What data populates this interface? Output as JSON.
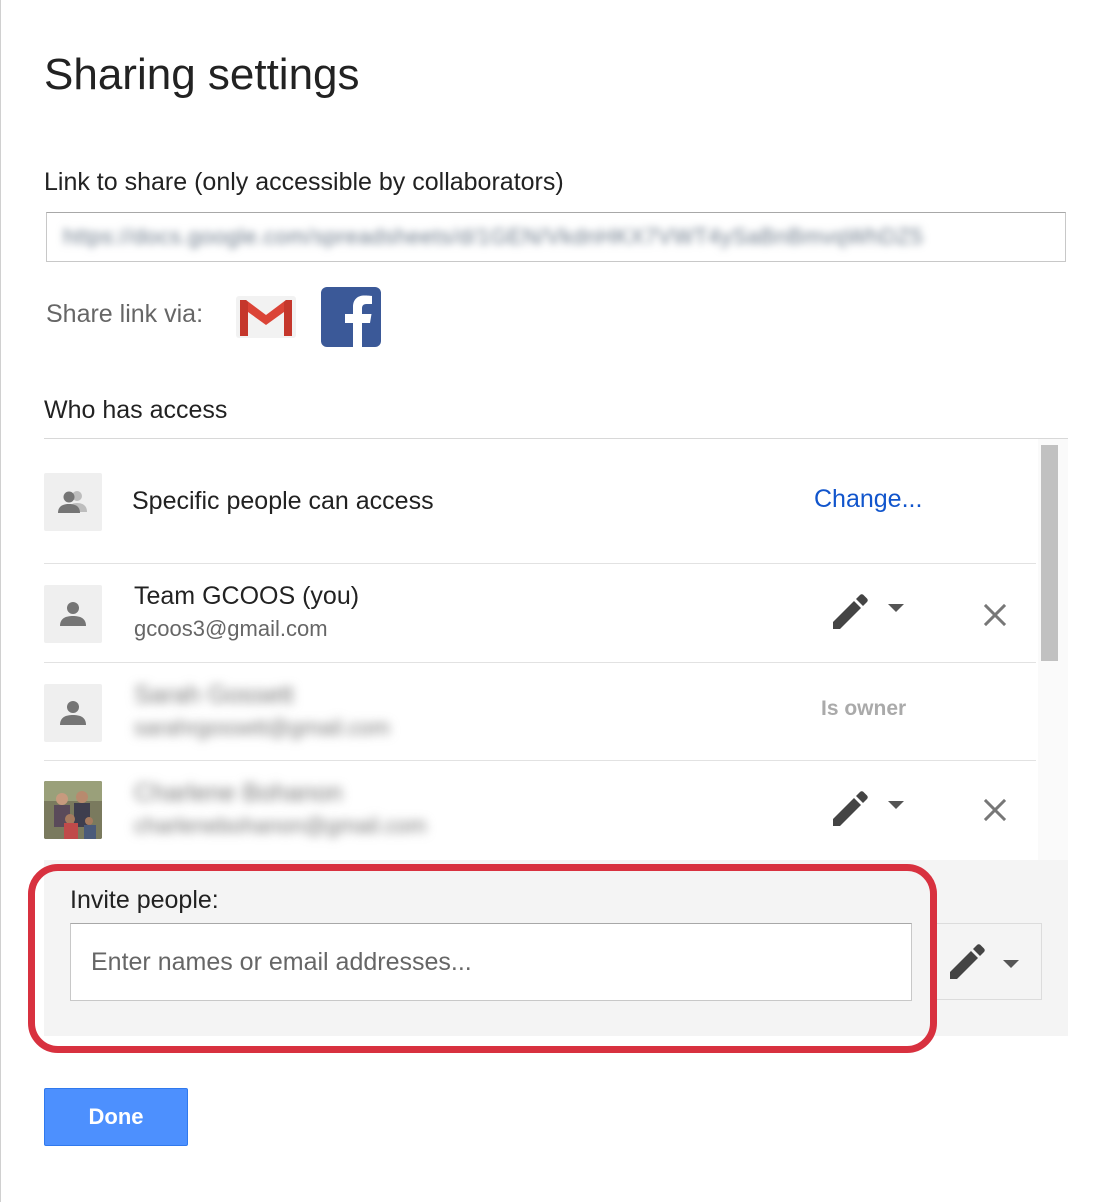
{
  "dialog": {
    "title": "Sharing settings"
  },
  "link_section": {
    "label": "Link to share (only accessible by collaborators)",
    "url": "https://docs.google.com/spreadsheets/d/1GEN/VkdnHKX7VWT4ySaBnBmvqWhDZ5"
  },
  "share_via": {
    "label": "Share link via:",
    "icons": [
      "gmail-icon",
      "facebook-icon"
    ],
    "colors": {
      "gmail_red": "#db4437",
      "facebook_blue": "#3b5998"
    }
  },
  "who_has_access": {
    "label": "Who has access",
    "visibility": {
      "text": "Specific people can access",
      "change_label": "Change..."
    },
    "people": [
      {
        "name": "Team GCOOS (you)",
        "email": "gcoos3@gmail.com",
        "role_icon": "pencil-icon",
        "removable": true
      },
      {
        "name": "Sarah Gossett",
        "email": "sarahrgossett@gmail.com",
        "role_text": "Is owner",
        "blurred": true
      },
      {
        "name": "Charlene Bohanon",
        "email": "charlenebohanon@gmail.com",
        "role_icon": "pencil-icon",
        "removable": true,
        "blurred": true
      }
    ]
  },
  "invite": {
    "label": "Invite people:",
    "placeholder": "Enter names or email addresses...",
    "value": ""
  },
  "footer": {
    "done_label": "Done"
  },
  "colors": {
    "link": "#1155cc",
    "primary_button": "#4d90fe",
    "highlight": "#d8313f"
  }
}
